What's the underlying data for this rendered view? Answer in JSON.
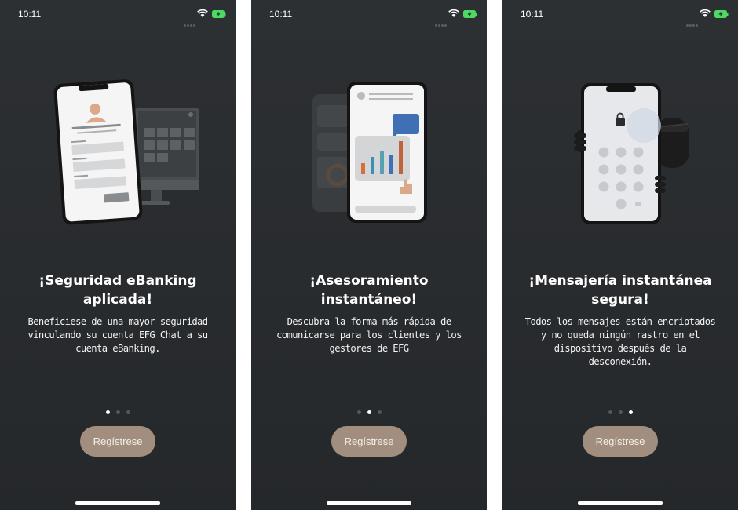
{
  "status": {
    "time": "10:11"
  },
  "screens": [
    {
      "title": "¡Seguridad eBanking aplicada!",
      "description": "Beneficiese de una mayor seguridad vinculando su cuenta EFG Chat a su cuenta eBanking.",
      "button": "Regístrese",
      "active_page": 1,
      "illustration": "phone-form-and-desktop"
    },
    {
      "title": "¡Asesoramiento instantáneo!",
      "description": "Descubra la forma más rápida de comunicarse para los clientes y los gestores de EFG",
      "button": "Regístrese",
      "active_page": 2,
      "illustration": "phone-chat-with-chart"
    },
    {
      "title": "¡Mensajería instantánea segura!",
      "description": "Todos los mensajes están encriptados y no queda ningún rastro en el dispositivo después de la desconexión.",
      "button": "Regístrese",
      "active_page": 3,
      "illustration": "phone-lock-keypad-with-hidden-figure"
    }
  ],
  "page_count": 3,
  "colors": {
    "background": "#2a2d30",
    "button": "#a18e7e",
    "accent_blue": "#3f6fb4",
    "accent_orange": "#d2713b",
    "skin": "#d9a98a"
  }
}
